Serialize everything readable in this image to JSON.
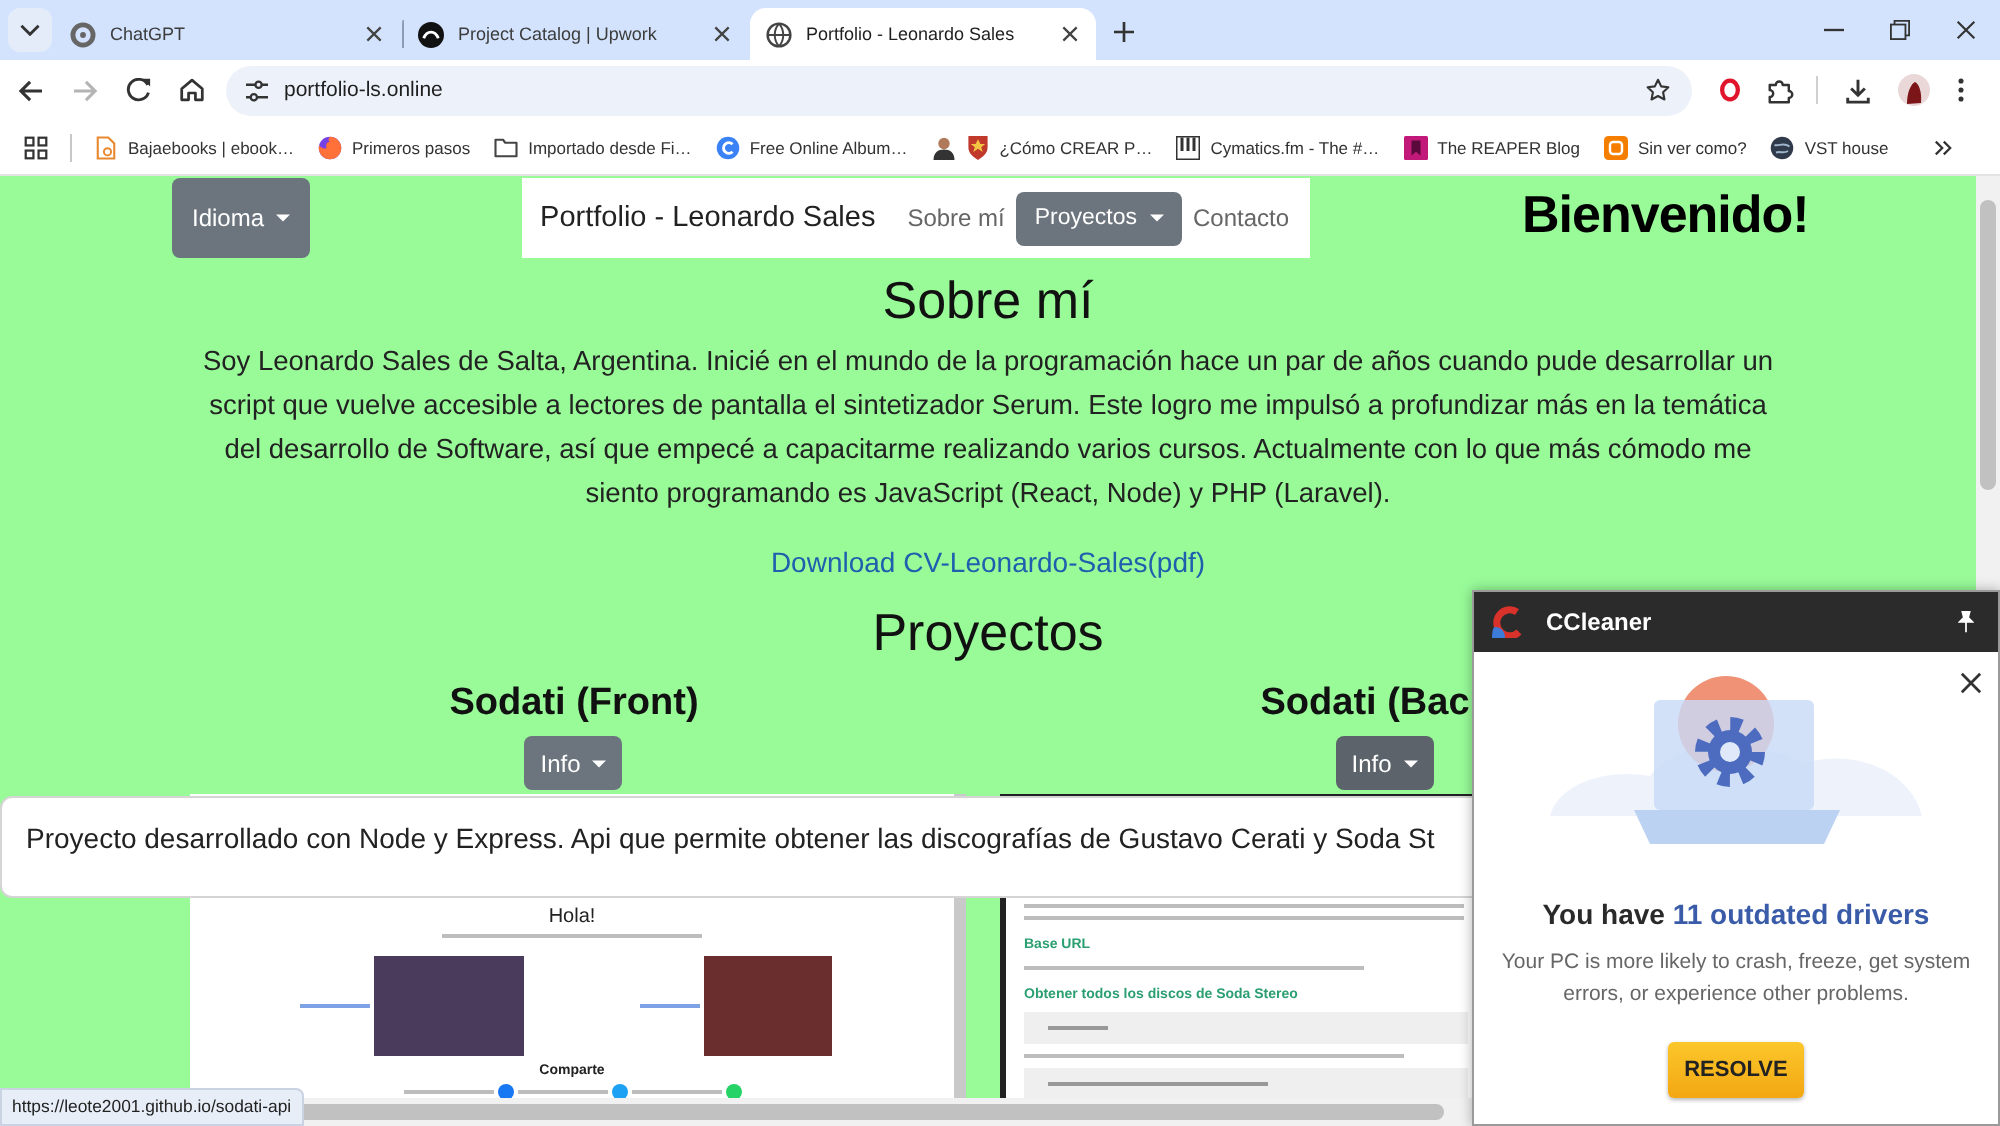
{
  "browser": {
    "tabs": [
      {
        "title": "ChatGPT",
        "selected": false
      },
      {
        "title": "Project Catalog | Upwork",
        "selected": false
      },
      {
        "title": "Portfolio - Leonardo Sales",
        "selected": true
      }
    ],
    "forward_disabled": true,
    "address": "portfolio-ls.online",
    "bookmarks": [
      {
        "label": "Bajaebooks | ebook…"
      },
      {
        "label": "Primeros pasos"
      },
      {
        "label": "Importado desde Fi…"
      },
      {
        "label": "Free Online Album…"
      },
      {
        "label": "¿Cómo CREAR P…"
      },
      {
        "label": "Cymatics.fm - The #…"
      },
      {
        "label": "The REAPER Blog"
      },
      {
        "label": "Sin ver como?"
      },
      {
        "label": "VST house"
      }
    ],
    "status_url": "https://leote2001.github.io/sodati-api"
  },
  "page": {
    "language_button": "Idioma",
    "navbar": {
      "brand": "Portfolio - Leonardo Sales",
      "links": [
        {
          "label": "Sobre mí",
          "kind": "link"
        },
        {
          "label": "Proyectos",
          "kind": "dropdown"
        },
        {
          "label": "Contacto",
          "kind": "link"
        }
      ]
    },
    "welcome": "Bienvenido!",
    "about": {
      "heading": "Sobre mí",
      "text": "Soy Leonardo Sales de Salta, Argentina. Inicié en el mundo de la programación hace un par de años cuando pude desarrollar un script que vuelve accesible a lectores de pantalla el sintetizador Serum. Este logro me impulsó a profundizar más en la temática del desarrollo de Software, así que empecé a capacitarme realizando varios cursos. Actualmente con lo que más cómodo me siento programando es JavaScript (React, Node) y PHP (Laravel).",
      "cv_link": "Download CV-Leonardo-Sales(pdf)"
    },
    "projects": {
      "heading": "Proyectos",
      "items": [
        {
          "title": "Sodati (Front)",
          "button": "Info",
          "expanded": false,
          "preview": {
            "kind": "website",
            "heading": "Hola!",
            "share_heading": "Comparte"
          }
        },
        {
          "title": "Sodati (Bac",
          "button": "Info",
          "expanded": true,
          "description": "Proyecto desarrollado con Node y Express. Api que permite obtener las discografías de Gustavo Cerati y Soda St",
          "preview": {
            "kind": "docs",
            "sections": [
              "Base URL",
              "Obtener todos los discos de Soda Stereo"
            ]
          }
        }
      ]
    }
  },
  "popup": {
    "app_name": "CCleaner",
    "title": "You have",
    "title_highlight": "11 outdated drivers",
    "message": "Your PC is more likely to crash, freeze, get system errors, or experience other problems.",
    "button": "RESOLVE"
  }
}
